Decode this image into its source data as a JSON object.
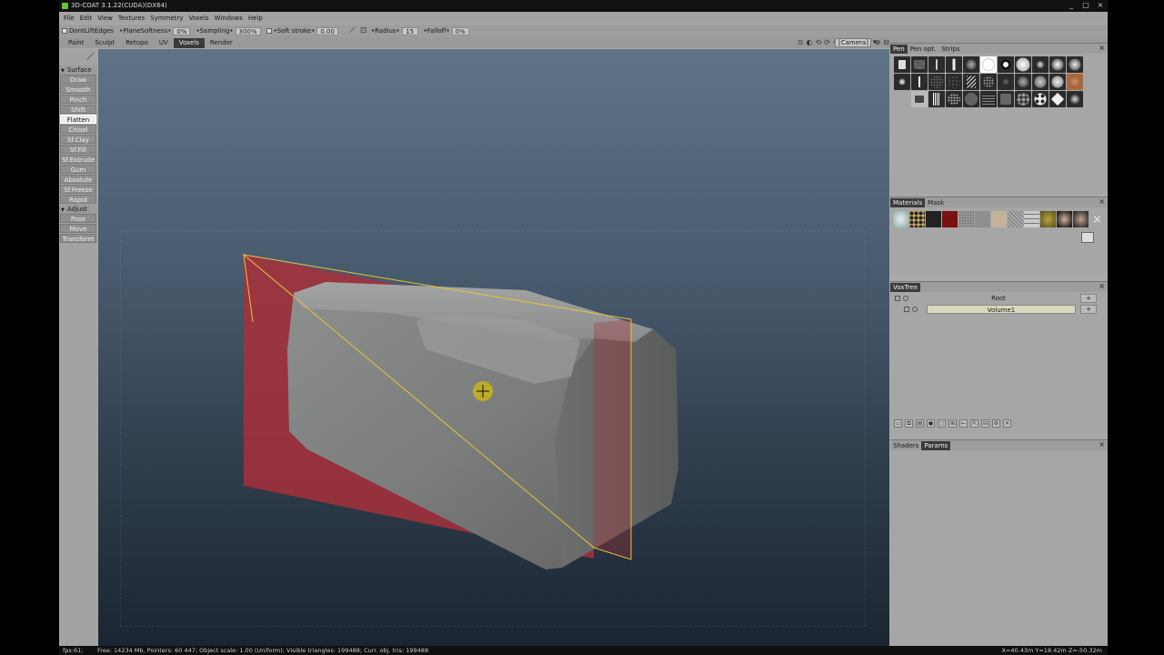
{
  "window": {
    "title": "3D-COAT 3.1.22(CUDA)(DX64)",
    "buttons": [
      "_",
      "□",
      "×"
    ]
  },
  "menu": [
    "File",
    "Edit",
    "View",
    "Textures",
    "Symmetry",
    "Voxels",
    "Windows",
    "Help"
  ],
  "tool_options": {
    "dont_lift_edges": "DontLiftEdges",
    "plane_softness_label": "•PlaneSoftness•",
    "plane_softness_value": "0%",
    "sampling_label": "•Sampling•",
    "sampling_value": "300%",
    "soft_stroke_label": "•Soft stroke•",
    "soft_stroke_value": "0.00",
    "radius_label": "•Radius•",
    "radius_value": "15",
    "falloff_label": "•Falloff•",
    "falloff_value": "0%"
  },
  "rooms": [
    "Paint",
    "Sculpt",
    "Retopo",
    "UV",
    "Voxels",
    "Render"
  ],
  "active_room": "Voxels",
  "camera": {
    "value": "[Camera]",
    "dropdown": "▾"
  },
  "view_icons": [
    "⊙",
    "◐",
    "⟲",
    "⟳",
    "✛",
    "⌕",
    "▷",
    "⊡",
    "⊞",
    "⊕",
    "⊟"
  ],
  "sidebar": {
    "surface_label": "Surface",
    "surface_tools": [
      "Draw",
      "Smooth",
      "Pinch",
      "Shift",
      "Flatten",
      "Chisel",
      "Sf.Clay",
      "Sf.Fill",
      "Sf.Extrude",
      "Gum",
      "Absolute",
      "Sf.Freeze",
      "Rapid"
    ],
    "adjust_label": "Adjust",
    "adjust_tools": [
      "Pose",
      "Move",
      "Transform"
    ],
    "active_tool": "Flatten"
  },
  "pen_panel": {
    "tabs": [
      "Pen",
      "Pen opt.",
      "Strips"
    ],
    "active_tab": "Pen"
  },
  "materials_panel": {
    "tabs": [
      "Materials",
      "Mask"
    ],
    "active_tab": "Materials"
  },
  "voxtree_panel": {
    "tab": "VoxTree",
    "root": "Root",
    "volume": "Volume1",
    "plus": "+"
  },
  "params_panel": {
    "tabs": [
      "Shaders",
      "Params"
    ],
    "active_tab": "Params"
  },
  "status": {
    "fps": "fps:61;",
    "info": "Free: 14234 Mb, Pointers: 60 447; Object scale: 1.00 (Uniform); Visible triangles: 199488; Curr. obj. tris: 199488",
    "coords": "X=40.43m Y=18.42m Z=-50.32m"
  },
  "colors": {
    "accent_active": "#3b3b3b",
    "plane_fill": "#a8303a",
    "plane_edge": "#e8c23a",
    "cursor": "#d8c21a"
  }
}
